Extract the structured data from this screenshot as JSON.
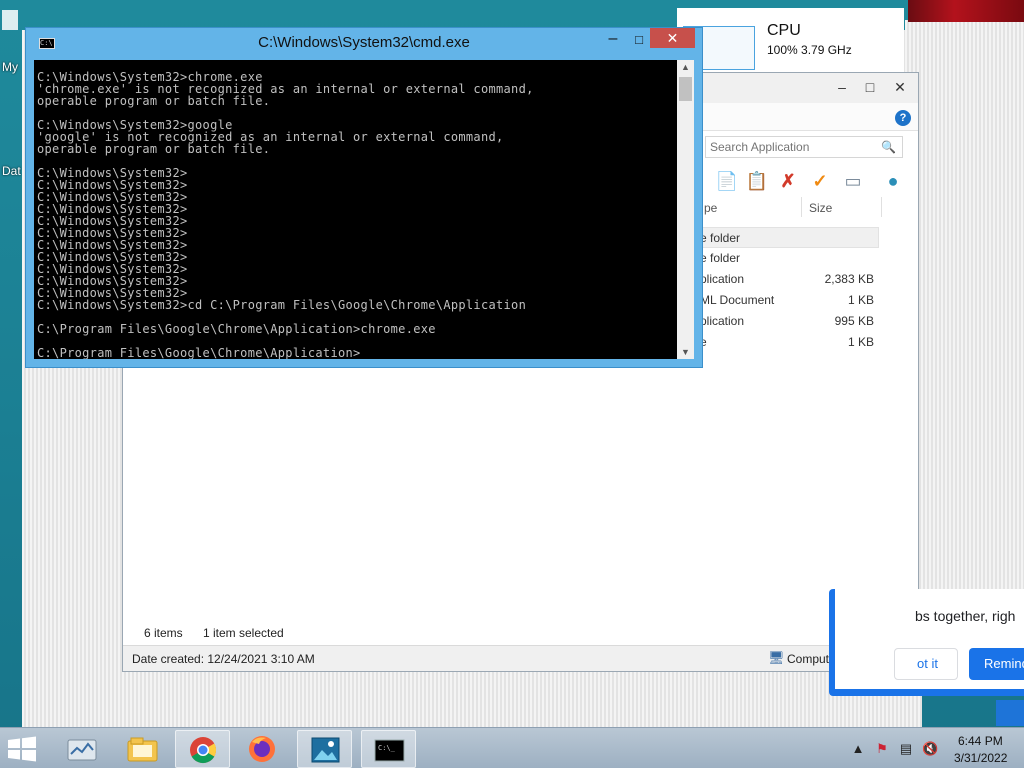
{
  "desktop": {
    "icon_labels": [
      "My",
      "Dat"
    ]
  },
  "cpu_panel": {
    "title": "CPU",
    "subtitle": "100%  3.79 GHz"
  },
  "cmd_window": {
    "title": "C:\\Windows\\System32\\cmd.exe",
    "controls": {
      "minimize": "–",
      "maximize": "□",
      "close": "✕"
    },
    "console_lines": [
      "C:\\Windows\\System32>chrome.exe",
      "'chrome.exe' is not recognized as an internal or external command,",
      "operable program or batch file.",
      "",
      "C:\\Windows\\System32>google",
      "'google' is not recognized as an internal or external command,",
      "operable program or batch file.",
      "",
      "C:\\Windows\\System32>",
      "C:\\Windows\\System32>",
      "C:\\Windows\\System32>",
      "C:\\Windows\\System32>",
      "C:\\Windows\\System32>",
      "C:\\Windows\\System32>",
      "C:\\Windows\\System32>",
      "C:\\Windows\\System32>",
      "C:\\Windows\\System32>",
      "C:\\Windows\\System32>",
      "C:\\Windows\\System32>",
      "C:\\Windows\\System32>cd C:\\Program Files\\Google\\Chrome\\Application",
      "",
      "C:\\Program Files\\Google\\Chrome\\Application>chrome.exe",
      "",
      "C:\\Program Files\\Google\\Chrome\\Application>"
    ]
  },
  "explorer": {
    "controls": {
      "minimize": "–",
      "maximize": "□",
      "close": "✕"
    },
    "help_label": "?",
    "search": {
      "placeholder": "Search Application",
      "value": ""
    },
    "columns": {
      "type": "pe",
      "size": "Size"
    },
    "rows": [
      {
        "type": "e folder",
        "size": ""
      },
      {
        "type": "e folder",
        "size": ""
      },
      {
        "type": "plication",
        "size": "2,383 KB"
      },
      {
        "type": "ML Document",
        "size": "1 KB"
      },
      {
        "type": "plication",
        "size": "995 KB"
      },
      {
        "type": "e",
        "size": "1 KB"
      }
    ],
    "status": {
      "items": "6 items",
      "selected": "1 item selected"
    },
    "details": {
      "date_created": "Date created: 12/24/2021 3:10 AM",
      "location": "Computer"
    }
  },
  "notification": {
    "text": "bs together, righ",
    "button_secondary": "ot it",
    "button_primary": "Remind"
  },
  "taskbar": {
    "items": [
      "file-explorer-icon",
      "file-manager-icon",
      "chrome-icon",
      "firefox-icon",
      "photo-viewer-icon",
      "cmd-icon"
    ],
    "time": "6:44 PM",
    "date": "3/31/2022"
  }
}
